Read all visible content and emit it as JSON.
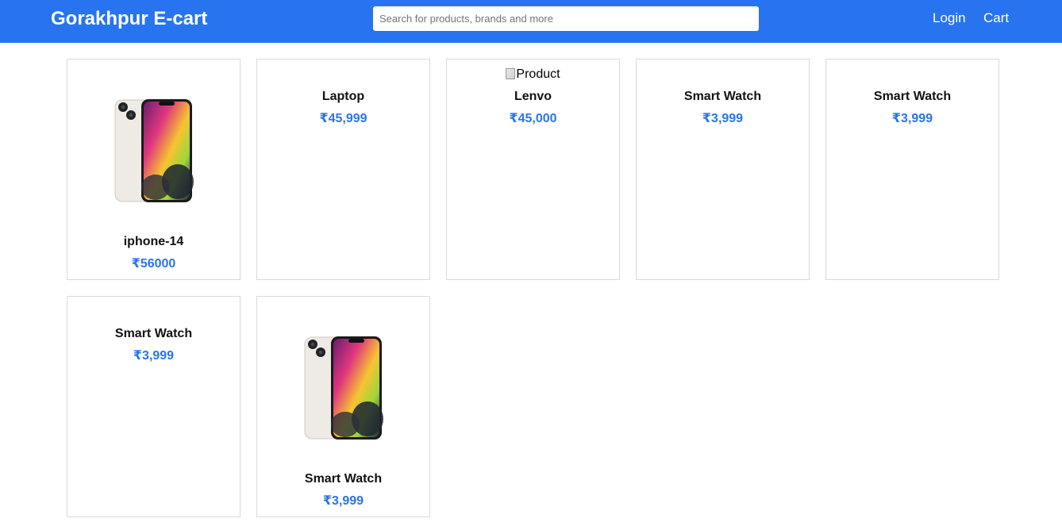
{
  "header": {
    "brand": "Gorakhpur E-cart",
    "search_placeholder": "Search for products, brands and more",
    "login_label": "Login",
    "cart_label": "Cart"
  },
  "products": [
    {
      "name": "iphone-14",
      "price": "₹56000",
      "image": "phone"
    },
    {
      "name": "Laptop",
      "price": "₹45,999",
      "image": "none"
    },
    {
      "name": "Lenvo",
      "price": "₹45,000",
      "image": "broken",
      "alt": "Product"
    },
    {
      "name": "Smart Watch",
      "price": "₹3,999",
      "image": "none"
    },
    {
      "name": "Smart Watch",
      "price": "₹3,999",
      "image": "none"
    },
    {
      "name": "Smart Watch",
      "price": "₹3,999",
      "image": "none"
    },
    {
      "name": "Smart Watch",
      "price": "₹3,999",
      "image": "phone"
    }
  ],
  "colors": {
    "brand_blue": "#2874f0",
    "card_border": "#d9d9d9"
  }
}
